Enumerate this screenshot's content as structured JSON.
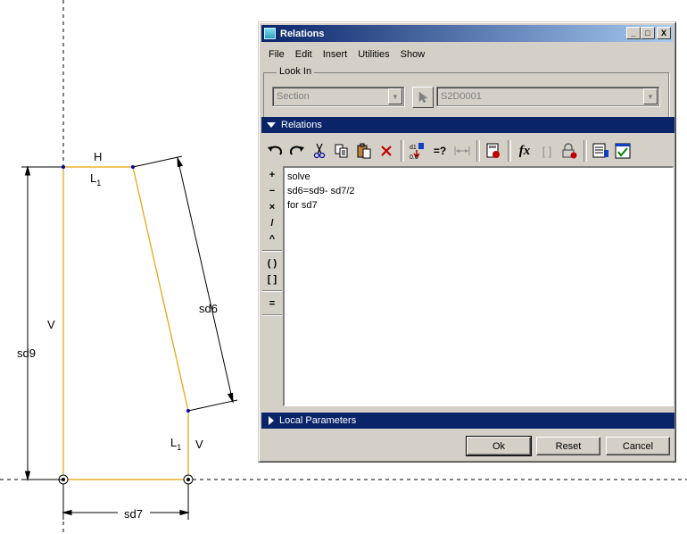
{
  "sketch": {
    "labels": {
      "h": "H",
      "l1_top": "L",
      "l1_top_sub": "1",
      "v_left": "V",
      "sd9": "sd9",
      "sd6": "sd6",
      "l1_right": "L",
      "l1_right_sub": "1",
      "v_right": "V",
      "sd7": "sd7"
    },
    "colors": {
      "edge": "#e8a000",
      "dimension": "#000000",
      "point": "#0000c0",
      "centerline": "#000000"
    }
  },
  "dialog": {
    "title": "Relations",
    "window_buttons": {
      "minimize": "_",
      "maximize": "□",
      "close": "X"
    },
    "menu": [
      "File",
      "Edit",
      "Insert",
      "Utilities",
      "Show"
    ],
    "look_in": {
      "legend": "Look In",
      "type_value": "Section",
      "object_value": "S2D0001"
    },
    "relations_section": "Relations",
    "sidebar_ops": [
      "+",
      "−",
      "×",
      "/",
      "^",
      "( )",
      "[ ]",
      "="
    ],
    "editor_lines": [
      "solve",
      "sd6=sd9- sd7/2",
      "for sd7"
    ],
    "toolbar_text": {
      "eval": "=?",
      "fx": "fx",
      "brackets": "[ ]"
    },
    "local_parameters_section": "Local Parameters",
    "buttons": {
      "ok": "Ok",
      "reset": "Reset",
      "cancel": "Cancel"
    },
    "colors": {
      "title_start": "#0a246a",
      "title_end": "#a6caf0",
      "section_bar": "#0a246a",
      "face": "#d4d0c8"
    }
  }
}
